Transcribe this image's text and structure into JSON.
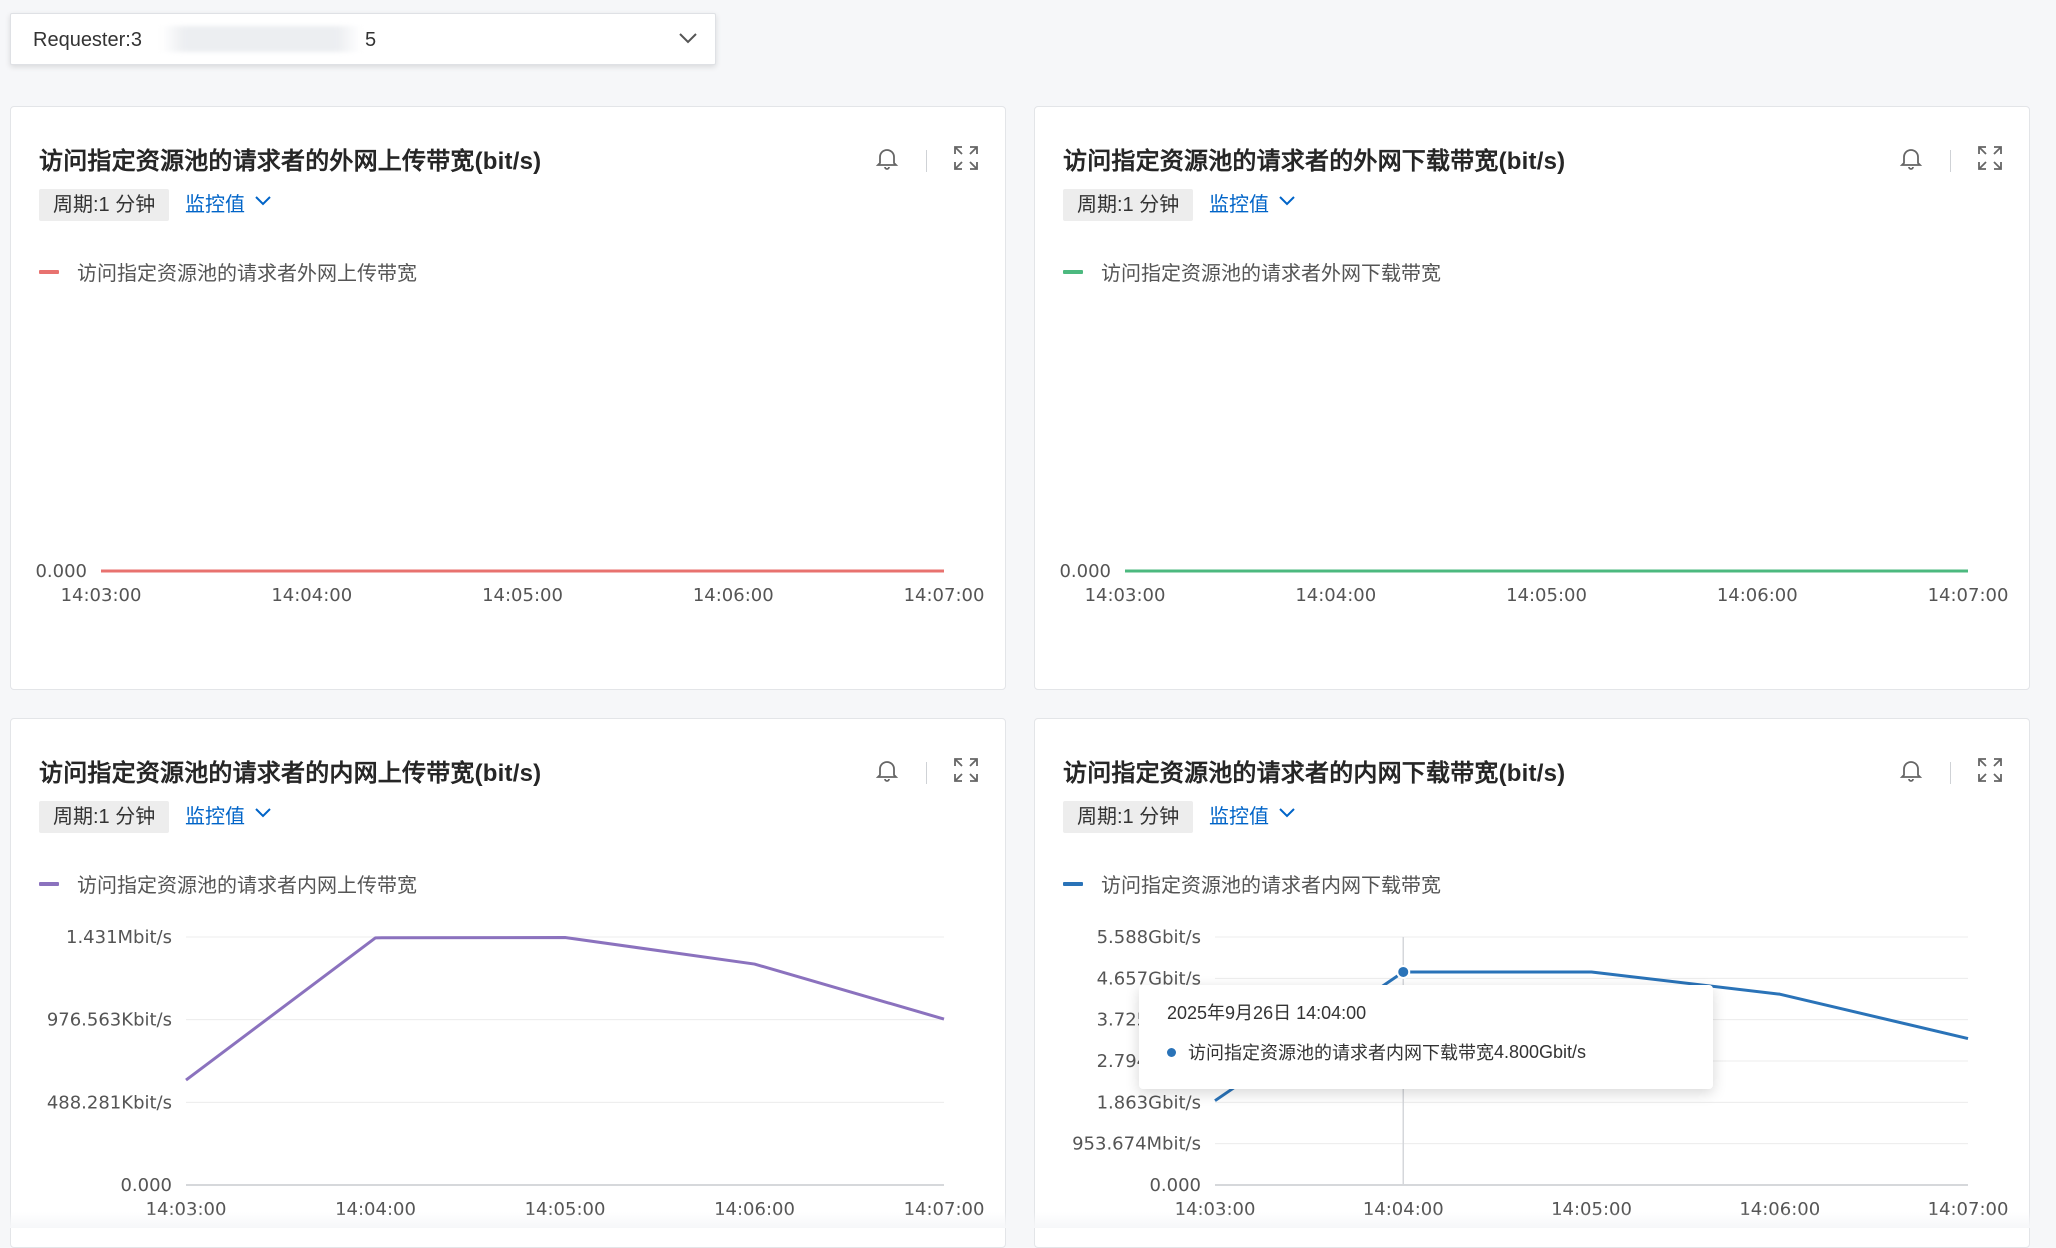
{
  "requester": {
    "label_prefix": "Requester:3",
    "label_suffix": "5"
  },
  "panels": [
    {
      "title": "访问指定资源池的请求者的外网上传带宽(bit/s)",
      "period": "周期:1 分钟",
      "metric": "监控值",
      "legend": "访问指定资源池的请求者外网上传带宽",
      "color": "#e8726f"
    },
    {
      "title": "访问指定资源池的请求者的外网下载带宽(bit/s)",
      "period": "周期:1 分钟",
      "metric": "监控值",
      "legend": "访问指定资源池的请求者外网下载带宽",
      "color": "#4cb97f"
    },
    {
      "title": "访问指定资源池的请求者的内网上传带宽(bit/s)",
      "period": "周期:1 分钟",
      "metric": "监控值",
      "legend": "访问指定资源池的请求者内网上传带宽",
      "color": "#8b72be"
    },
    {
      "title": "访问指定资源池的请求者的内网下载带宽(bit/s)",
      "period": "周期:1 分钟",
      "metric": "监控值",
      "legend": "访问指定资源池的请求者内网下载带宽",
      "color": "#2a73b8"
    }
  ],
  "tooltip": {
    "time": "2025年9月26日 14:04:00",
    "series": "访问指定资源池的请求者内网下载带宽",
    "value": "4.800Gbit/s"
  },
  "chart_data": [
    {
      "type": "line",
      "title": "访问指定资源池的请求者的外网上传带宽(bit/s)",
      "x": [
        "14:03:00",
        "14:04:00",
        "14:05:00",
        "14:06:00",
        "14:07:00"
      ],
      "x_ticks": [
        "14:03:00",
        "14:04:00",
        "14:05:00",
        "14:06:00",
        "14:07:00"
      ],
      "y_ticks": [
        {
          "v": 0,
          "label": "0.000"
        }
      ],
      "ylim": [
        0,
        1
      ],
      "series": [
        {
          "name": "访问指定资源池的请求者外网上传带宽",
          "values": [
            0,
            0,
            0,
            0,
            0
          ]
        }
      ],
      "legend": "top-left",
      "grid": false
    },
    {
      "type": "line",
      "title": "访问指定资源池的请求者的外网下载带宽(bit/s)",
      "x": [
        "14:03:00",
        "14:04:00",
        "14:05:00",
        "14:06:00",
        "14:07:00"
      ],
      "x_ticks": [
        "14:03:00",
        "14:04:00",
        "14:05:00",
        "14:06:00",
        "14:07:00"
      ],
      "y_ticks": [
        {
          "v": 0,
          "label": "0.000"
        }
      ],
      "ylim": [
        0,
        1
      ],
      "series": [
        {
          "name": "访问指定资源池的请求者外网下载带宽",
          "values": [
            0,
            0,
            0,
            0,
            0
          ]
        }
      ],
      "legend": "top-left",
      "grid": false
    },
    {
      "type": "line",
      "title": "访问指定资源池的请求者的内网上传带宽(bit/s)",
      "x": [
        "14:03:00",
        "14:04:00",
        "14:05:00",
        "14:06:00",
        "14:07:00"
      ],
      "x_ticks": [
        "14:03:00",
        "14:04:00",
        "14:05:00",
        "14:06:00",
        "14:07:00"
      ],
      "y_unit": "Kbit/s",
      "y_ticks": [
        {
          "v": 0,
          "label": "0.000"
        },
        {
          "v": 488.281,
          "label": "488.281Kbit/s"
        },
        {
          "v": 976.563,
          "label": "976.563Kbit/s"
        },
        {
          "v": 1464.844,
          "label": "1.431Mbit/s"
        }
      ],
      "ylim": [
        0,
        1464.844
      ],
      "series": [
        {
          "name": "访问指定资源池的请求者内网上传带宽",
          "values": [
            620,
            1460,
            1462,
            1305,
            980
          ]
        }
      ],
      "legend": "top-left",
      "grid": true
    },
    {
      "type": "line",
      "title": "访问指定资源池的请求者的内网下载带宽(bit/s)",
      "x": [
        "14:03:00",
        "14:04:00",
        "14:05:00",
        "14:06:00",
        "14:07:00"
      ],
      "x_ticks": [
        "14:03:00",
        "14:04:00",
        "14:05:00",
        "14:06:00",
        "14:07:00"
      ],
      "y_unit": "Gbit/s",
      "y_ticks": [
        {
          "v": 0,
          "label": "0.000"
        },
        {
          "v": 0.931,
          "label": "953.674Mbit/s"
        },
        {
          "v": 1.863,
          "label": "1.863Gbit/s"
        },
        {
          "v": 2.794,
          "label": "2.794Gbit/s"
        },
        {
          "v": 3.725,
          "label": "3.725Gbit/s"
        },
        {
          "v": 4.657,
          "label": "4.657Gbit/s"
        },
        {
          "v": 5.588,
          "label": "5.588Gbit/s"
        }
      ],
      "ylim": [
        0,
        5.588
      ],
      "series": [
        {
          "name": "访问指定资源池的请求者内网下载带宽",
          "values": [
            1.9,
            4.8,
            4.8,
            4.3,
            3.3
          ]
        }
      ],
      "highlight_index": 1,
      "legend": "top-left",
      "grid": true
    }
  ]
}
